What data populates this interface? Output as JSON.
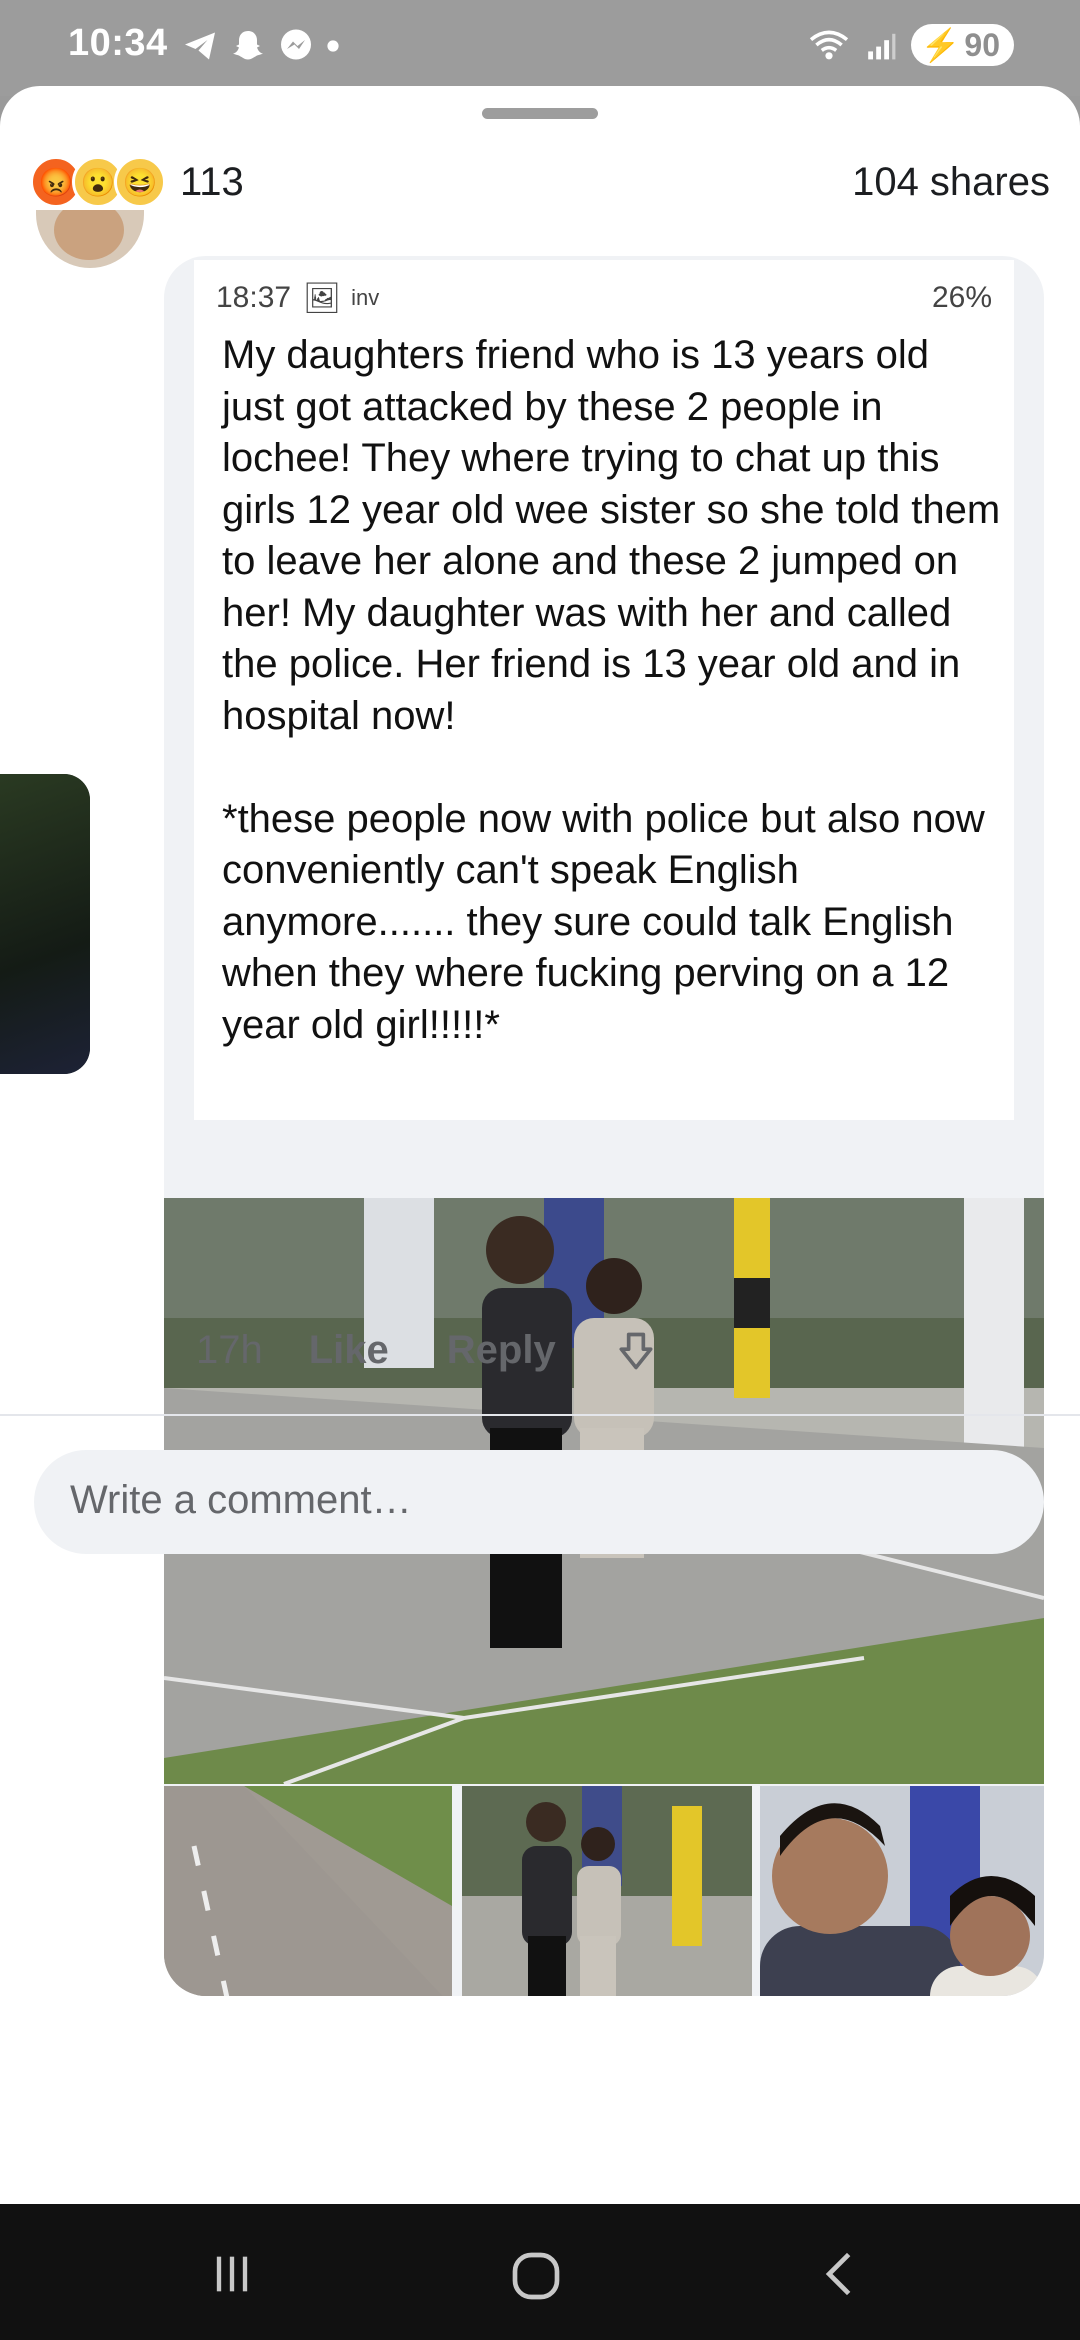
{
  "status_bar": {
    "time": "10:34",
    "battery": "90",
    "left_icons": [
      "telegram-icon",
      "snapchat-icon",
      "messenger-icon",
      "dot-icon"
    ],
    "right_icons": [
      "wifi-icon",
      "signal-icon",
      "battery-icon"
    ]
  },
  "reactions": {
    "count": "113",
    "shares": "104 shares",
    "types": [
      "angry",
      "wow",
      "haha"
    ]
  },
  "comment": {
    "screenshot_status": {
      "time": "18:37",
      "indicator": "inv",
      "battery": "26%"
    },
    "text": "My daughters friend who is 13 years old just got attacked by these 2 people in lochee! They where trying to chat up this girls 12 year old wee sister so she told them to leave her alone and these 2 jumped on her! My daughter was with her and called the police. Her friend is 13 year old and in hospital now!\n\n*these people now with police but also now conveniently can't speak English anymore....... they sure could talk English when they where fucking perving on a 12 year old girl!!!!!*",
    "time": "17h",
    "like": "Like",
    "reply": "Reply"
  },
  "composer": {
    "placeholder": "Write a comment…"
  },
  "colors": {
    "status_bar_bg": "#9c9c9c",
    "sheet_bg": "#ffffff",
    "bubble_bg": "#f0f2f5",
    "meta_text": "#65676b",
    "nav_bg": "#111111"
  }
}
